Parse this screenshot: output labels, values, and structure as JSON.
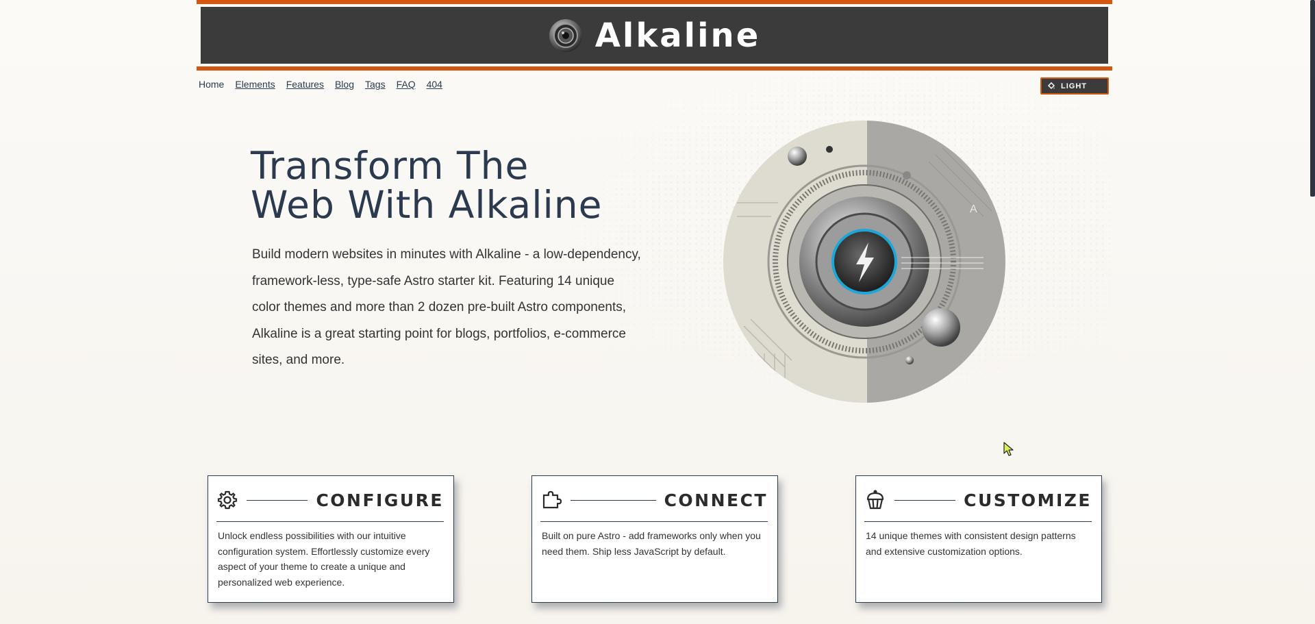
{
  "brand": {
    "name": "Alkaline",
    "logo_icon": "camera-lens-icon"
  },
  "colors": {
    "accent": "#d4560f",
    "header_bg": "#3b3b3b",
    "text": "#2b3a4e",
    "lens_ring": "#1ea7d6"
  },
  "nav": {
    "items": [
      {
        "label": "Home"
      },
      {
        "label": "Elements"
      },
      {
        "label": "Features"
      },
      {
        "label": "Blog"
      },
      {
        "label": "Tags"
      },
      {
        "label": "FAQ"
      },
      {
        "label": "404"
      }
    ]
  },
  "theme_toggle": {
    "label": "LIGHT",
    "icon": "paint-bucket-icon"
  },
  "hero": {
    "title_line1": "Transform The",
    "title_line2": "Web With Alkaline",
    "text": "Build modern websites in minutes with Alkaline - a low-dependency, framework-less, type-safe Astro starter kit. Featuring 14 unique color themes and more than 2 dozen pre-built Astro components, Alkaline is a great starting point for blogs, portfolios, e-commerce sites, and more."
  },
  "features": [
    {
      "title": "CONFIGURE",
      "icon": "gear-icon",
      "text": "Unlock endless possibilities with our intuitive configuration system. Effortlessly customize every aspect of your theme to create a unique and personalized web experience."
    },
    {
      "title": "CONNECT",
      "icon": "puzzle-piece-icon",
      "text": "Built on pure Astro - add frameworks only when you need them. Ship less JavaScript by default."
    },
    {
      "title": "CUSTOMIZE",
      "icon": "cupcake-icon",
      "text": "14 unique themes with consistent design patterns and extensive customization options."
    }
  ]
}
